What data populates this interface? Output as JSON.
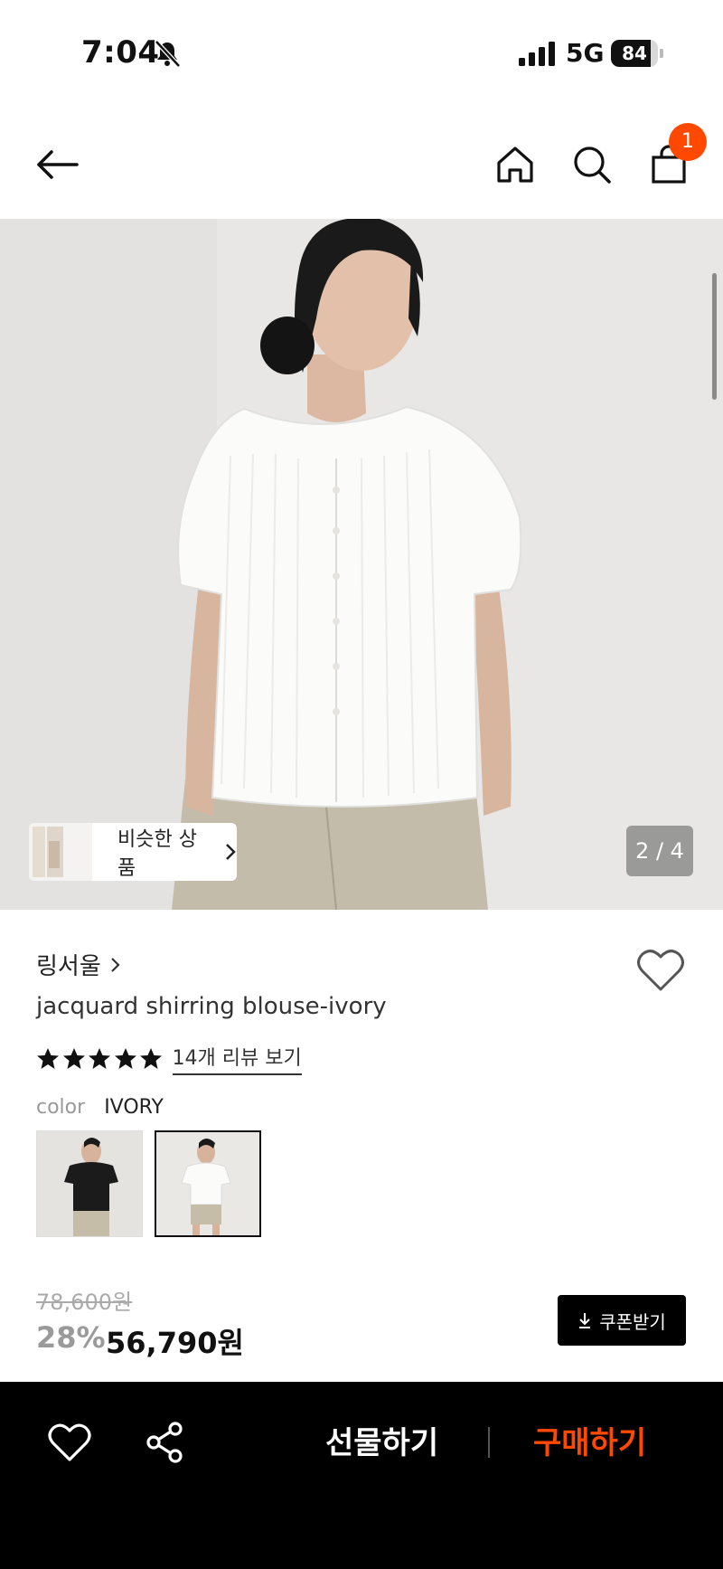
{
  "status_bar": {
    "time": "7:04",
    "network": "5G",
    "battery": 84,
    "battery_label": "84"
  },
  "nav": {
    "cart_count": "1"
  },
  "gallery": {
    "similar_label": "비슷한 상품",
    "page_counter": "2 / 4"
  },
  "product": {
    "brand": "링서울",
    "title": "jacquard shirring blouse-ivory",
    "rating": 5,
    "review_link": "14개 리뷰 보기",
    "color_label": "color",
    "color_value": "IVORY",
    "swatches": [
      "black",
      "ivory"
    ],
    "original_price": "78,600원",
    "discount": "28%",
    "sale_price": "56,790원",
    "coupon_label": "쿠폰받기"
  },
  "bottom_bar": {
    "gift_label": "선물하기",
    "buy_label": "구매하기"
  },
  "colors": {
    "accent": "#ff4800",
    "bar": "#000000"
  },
  "icons": [
    "bell-off-icon",
    "signal-icon",
    "back-arrow-icon",
    "home-icon",
    "search-icon",
    "bag-icon",
    "chevron-right-icon",
    "heart-outline-icon",
    "star-icon",
    "download-icon",
    "share-icon"
  ]
}
